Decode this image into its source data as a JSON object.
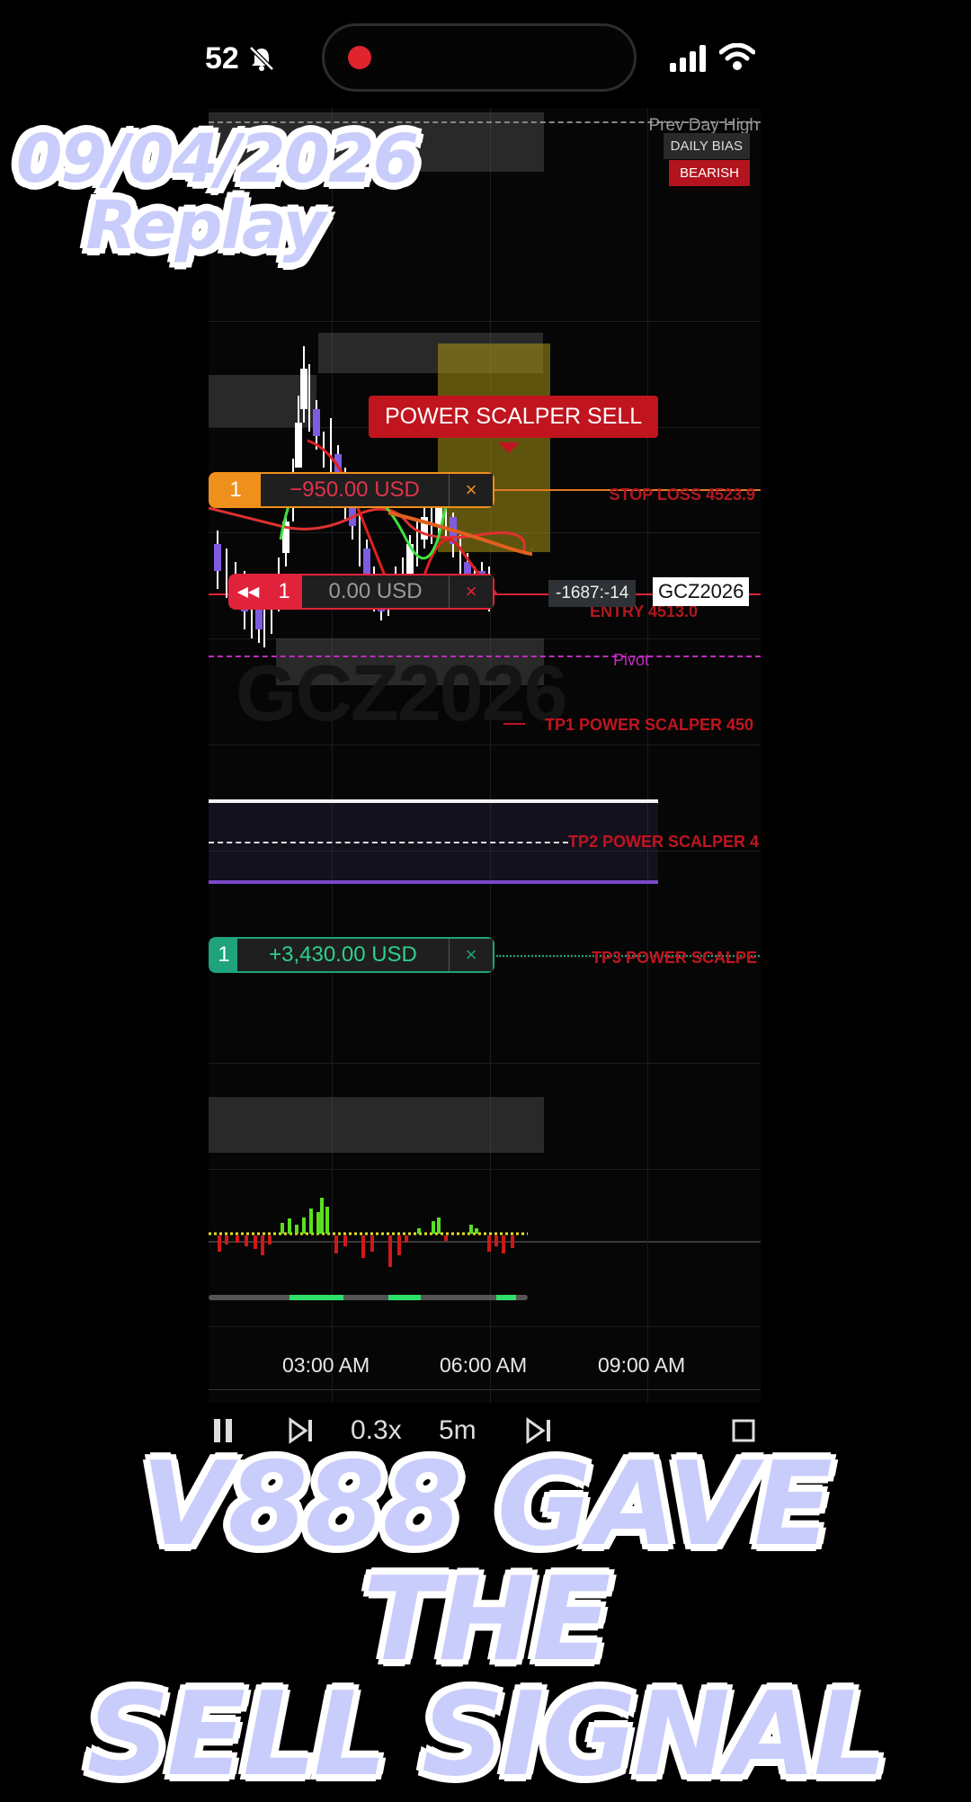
{
  "status_bar": {
    "time": "52"
  },
  "chart": {
    "prev_day_high": "Prev Day High",
    "daily_bias_label": "DAILY BIAS",
    "daily_bias_value": "BEARISH",
    "signal": "POWER SCALPER SELL",
    "stop_loss_label": "STOP LOSS 4523.9",
    "entry_label": "ENTRY 4513.0",
    "pivot_label": "Pivot",
    "tp1_label": "TP1 POWER SCALPER 450",
    "tp2_label": "TP2 POWER SCALPER 4",
    "tp3_label": "TP3 POWER SCALPE",
    "countdown": "-1687:-14",
    "symbol": "GCZ2026",
    "watermark": "GCZ2026",
    "x_axis": [
      "03:00 AM",
      "06:00 AM",
      "09:00 AM"
    ]
  },
  "orders": {
    "stop": {
      "qty": "1",
      "pnl": "−950.00 USD",
      "close": "×"
    },
    "entry": {
      "rewind": "◀◀",
      "qty": "1",
      "pnl": "0.00 USD",
      "close": "×"
    },
    "tp3": {
      "qty": "1",
      "pnl": "+3,430.00 USD",
      "close": "×"
    }
  },
  "replay_controls": {
    "speed": "0.3x",
    "timeframe": "5m"
  },
  "overlays": {
    "date": "09/04/2026",
    "replay": "Replay",
    "headline_line1": "V888 GAVE THE",
    "headline_line2": "SELL SIGNAL"
  },
  "colors": {
    "bearish": "#b3141e",
    "stop": "#f0901c",
    "entry": "#e0233a",
    "take_profit": "#1fa37c",
    "pivot": "#c02cc0"
  }
}
